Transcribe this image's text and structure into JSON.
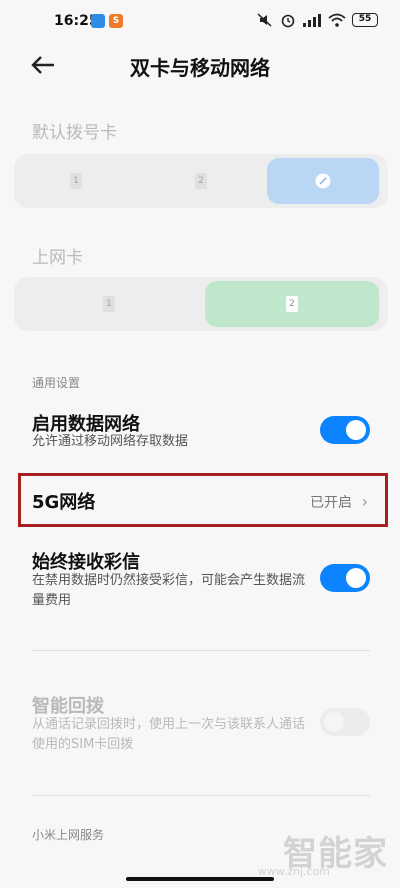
{
  "status": {
    "time": "16:25",
    "notif_app": "S",
    "battery": "55"
  },
  "header": {
    "title": "双卡与移动网络"
  },
  "default_dial": {
    "label": "默认拨号卡",
    "options": [
      "1",
      "2"
    ]
  },
  "data_sim": {
    "label": "上网卡",
    "options": [
      "1",
      "2"
    ]
  },
  "general": {
    "heading": "通用设置",
    "mobile_data": {
      "title": "启用数据网络",
      "subtitle": "允许通过移动网络存取数据",
      "enabled": true
    },
    "fiveg": {
      "title": "5G网络",
      "value": "已开启"
    },
    "mms": {
      "title": "始终接收彩信",
      "subtitle": "在禁用数据时仍然接受彩信，可能会产生数据流量费用",
      "enabled": true
    },
    "smart_callback": {
      "title": "智能回拨",
      "subtitle": "从通话记录回拨时，使用上一次与该联系人通话使用的SIM卡回拨",
      "enabled": false
    }
  },
  "xiaomi_service": {
    "heading": "小米上网服务"
  },
  "watermark": {
    "text": "智能家",
    "sub": "www.znj.com"
  }
}
